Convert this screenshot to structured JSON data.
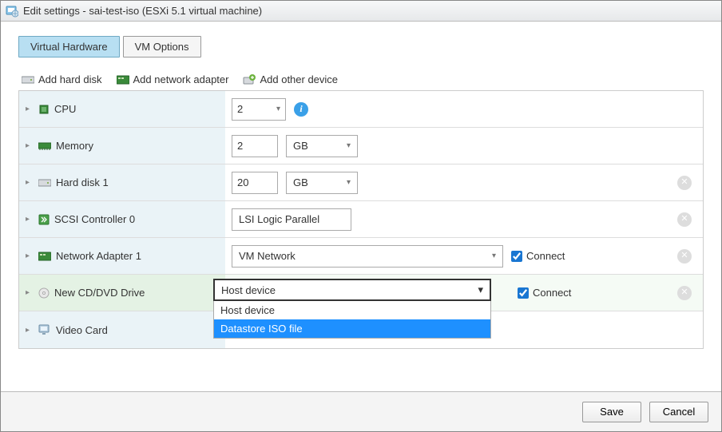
{
  "title": "Edit settings - sai-test-iso (ESXi 5.1 virtual machine)",
  "tabs": {
    "hardware": "Virtual Hardware",
    "vmoptions": "VM Options"
  },
  "toolbar": {
    "add_disk": "Add hard disk",
    "add_net": "Add network adapter",
    "add_other": "Add other device"
  },
  "rows": {
    "cpu": {
      "label": "CPU",
      "value": "2"
    },
    "memory": {
      "label": "Memory",
      "value": "2",
      "unit": "GB"
    },
    "hdd": {
      "label": "Hard disk 1",
      "value": "20",
      "unit": "GB"
    },
    "scsi": {
      "label": "SCSI Controller 0",
      "value": "LSI Logic Parallel"
    },
    "net": {
      "label": "Network Adapter 1",
      "value": "VM Network",
      "connect": "Connect"
    },
    "cd": {
      "label": "New CD/DVD Drive",
      "value": "Host device",
      "connect": "Connect",
      "options": [
        "Host device",
        "Datastore ISO file"
      ]
    },
    "video": {
      "label": "Video Card"
    }
  },
  "footer": {
    "save": "Save",
    "cancel": "Cancel"
  }
}
